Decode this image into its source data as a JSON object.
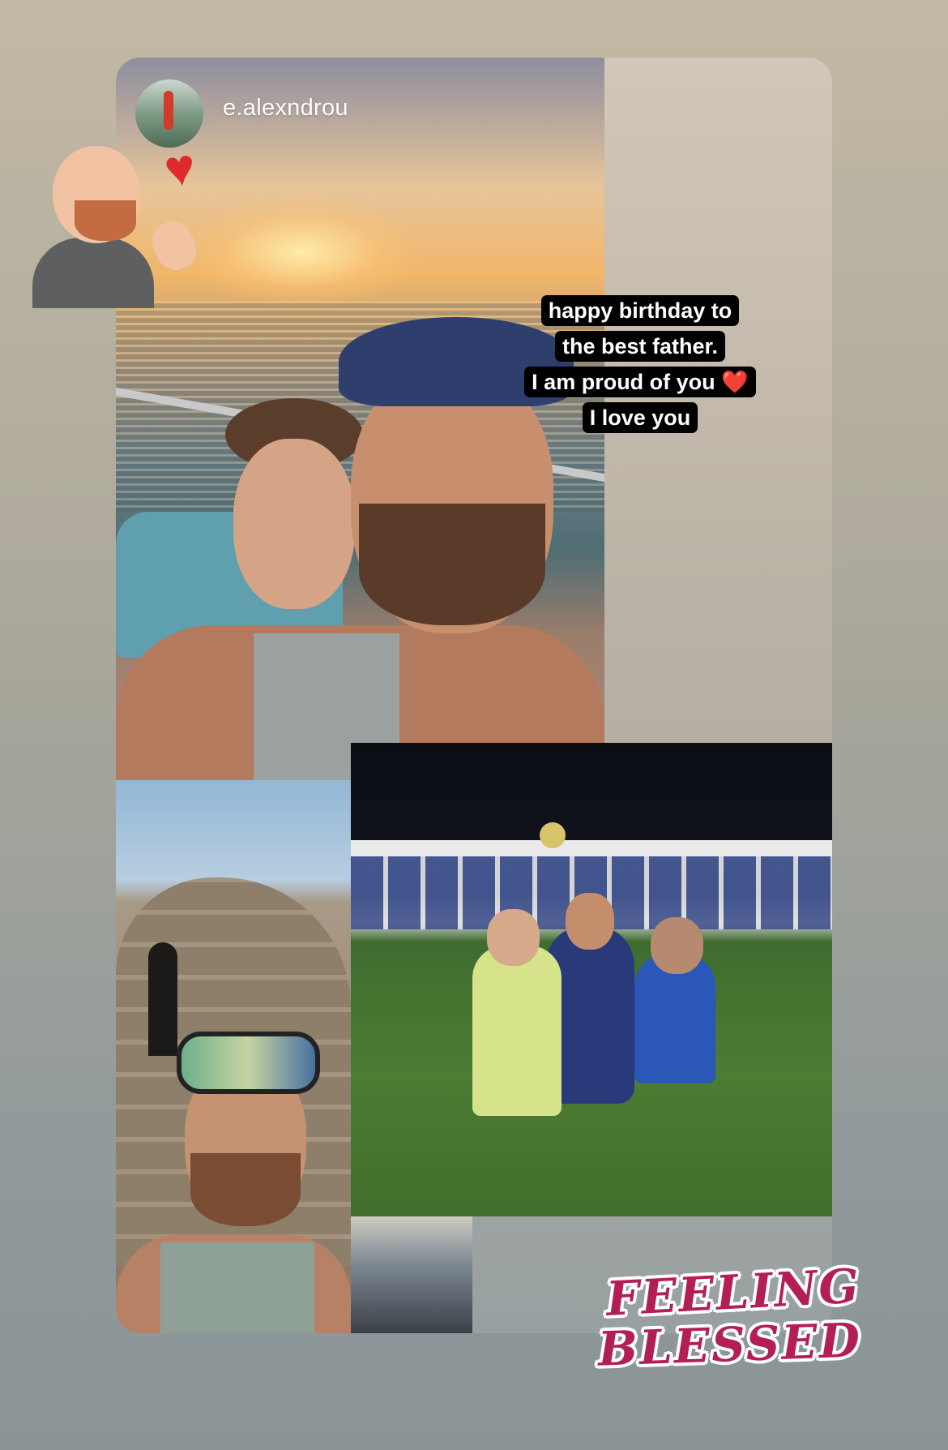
{
  "story": {
    "username": "e.alexndrou",
    "caption_lines": [
      "happy birthday to",
      "the best father.",
      "I am proud of you",
      "I love you"
    ],
    "caption_heart": "❤️",
    "sticker_lines": [
      "FEELING",
      "BLESSED"
    ]
  },
  "colors": {
    "caption_bg": "#000000",
    "caption_text": "#ffffff",
    "sticker_text": "#b31e55",
    "heart": "#e02a2a"
  },
  "icons": {
    "memoji": "memoji-blowing-kiss",
    "heart": "red-heart",
    "avatar": "profile-avatar"
  }
}
